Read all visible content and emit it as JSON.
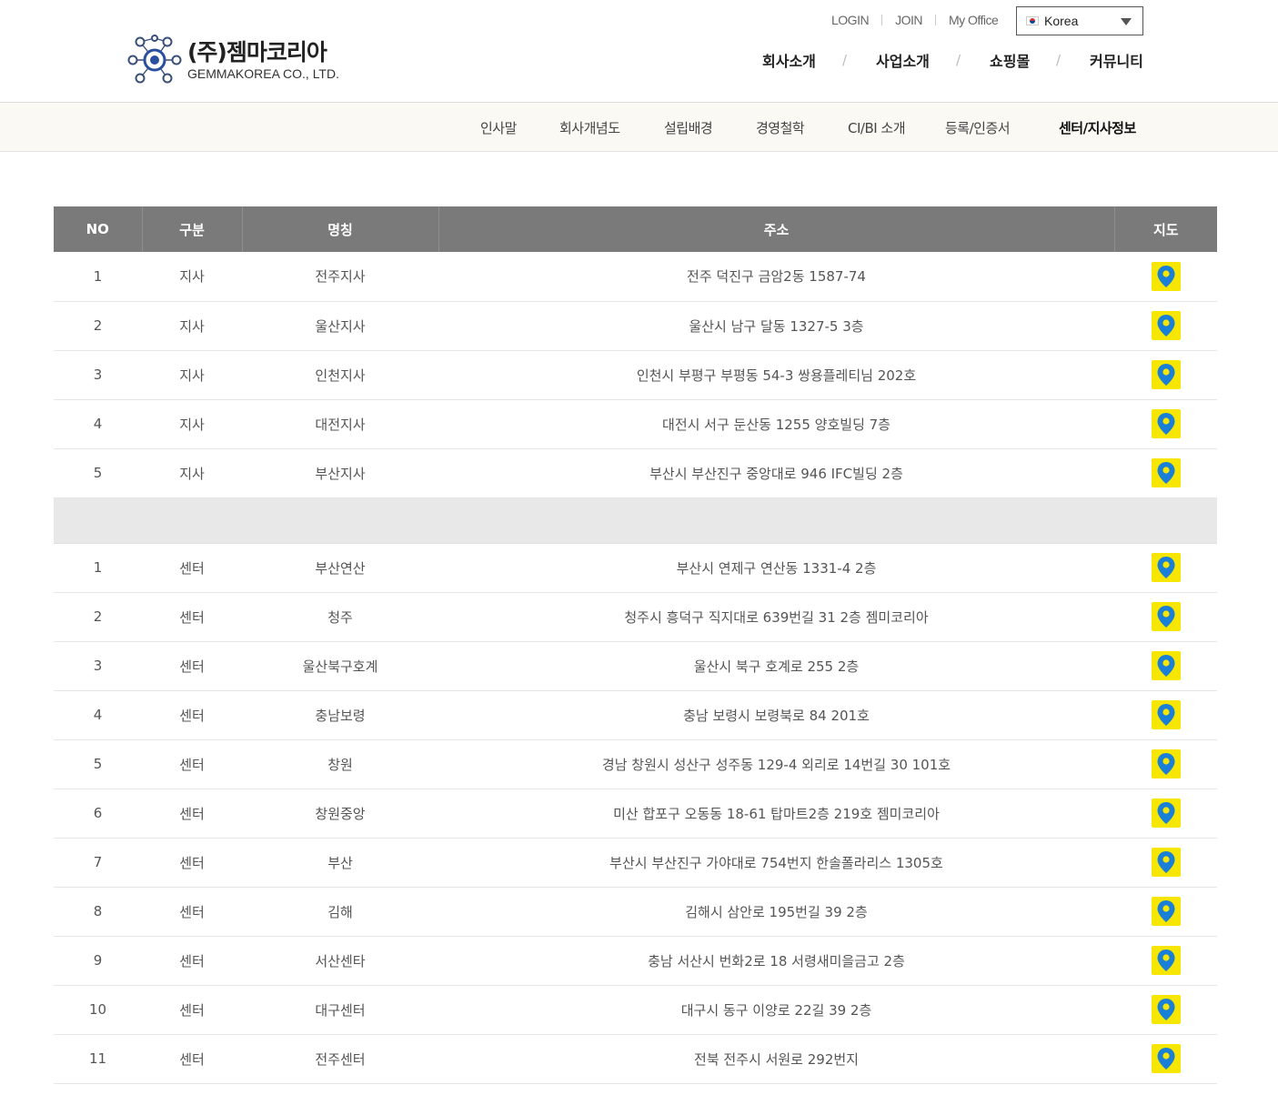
{
  "brand": {
    "name_ko": "(주)젬마코리아",
    "name_en": "GEMMAKOREA CO., LTD."
  },
  "utility": {
    "login": "LOGIN",
    "join": "JOIN",
    "my_office": "My Office",
    "language": "Korea"
  },
  "gnb": {
    "items": [
      "회사소개",
      "사업소개",
      "쇼핑몰",
      "커뮤니티"
    ],
    "separator": "/"
  },
  "subnav": {
    "items": [
      "인사말",
      "회사개념도",
      "설립배경",
      "경영철학",
      "CI/BI 소개",
      "등록/인증서",
      "센터/지사정보"
    ],
    "active_index": 6
  },
  "table": {
    "headers": {
      "no": "NO",
      "type": "구분",
      "name": "명칭",
      "address": "주소",
      "map": "지도"
    },
    "branches": [
      {
        "no": "1",
        "type": "지사",
        "name": "전주지사",
        "address": "전주 덕진구 금암2동 1587-74"
      },
      {
        "no": "2",
        "type": "지사",
        "name": "울산지사",
        "address": "울산시 남구 달동 1327-5 3층"
      },
      {
        "no": "3",
        "type": "지사",
        "name": "인천지사",
        "address": "인천시 부평구 부평동 54-3 쌍용플레티님 202호"
      },
      {
        "no": "4",
        "type": "지사",
        "name": "대전지사",
        "address": "대전시 서구 둔산동 1255 양호빌딩 7층"
      },
      {
        "no": "5",
        "type": "지사",
        "name": "부산지사",
        "address": "부산시 부산진구 중앙대로 946 IFC빌딩 2층"
      }
    ],
    "centers": [
      {
        "no": "1",
        "type": "센터",
        "name": "부산연산",
        "address": "부산시 연제구 연산동 1331-4 2층"
      },
      {
        "no": "2",
        "type": "센터",
        "name": "청주",
        "address": "청주시 흥덕구 직지대로 639번길 31 2층 젬미코리아"
      },
      {
        "no": "3",
        "type": "센터",
        "name": "울산북구호계",
        "address": "울산시 북구 호계로 255 2층"
      },
      {
        "no": "4",
        "type": "센터",
        "name": "충남보령",
        "address": "충남 보령시 보령북로 84 201호"
      },
      {
        "no": "5",
        "type": "센터",
        "name": "창원",
        "address": "경남 창원시 성산구 성주동 129-4 외리로 14번길 30 101호"
      },
      {
        "no": "6",
        "type": "센터",
        "name": "창원중앙",
        "address": "미산 합포구 오동동 18-61 탑마트2층 219호 젬미코리아"
      },
      {
        "no": "7",
        "type": "센터",
        "name": "부산",
        "address": "부산시 부산진구 가야대로 754번지 한솔폴라리스 1305호"
      },
      {
        "no": "8",
        "type": "센터",
        "name": "김해",
        "address": "김해시 삼안로 195번길 39 2층"
      },
      {
        "no": "9",
        "type": "센터",
        "name": "서산센타",
        "address": "충남 서산시 번화2로 18 서령새미을금고 2층"
      },
      {
        "no": "10",
        "type": "센터",
        "name": "대구센터",
        "address": "대구시 동구 이양로 22길 39 2층"
      },
      {
        "no": "11",
        "type": "센터",
        "name": "전주센터",
        "address": "전북 전주시 서원로 292번지"
      }
    ]
  },
  "colors": {
    "header_row": "#7a7a7a",
    "map_button": "#f7e600",
    "pin": "#1a7fd6",
    "subnav_bg": "#faf9f3"
  },
  "icons": {
    "map": "map-pin-icon",
    "language": "korea-flag-icon",
    "dropdown": "caret-down-icon"
  }
}
